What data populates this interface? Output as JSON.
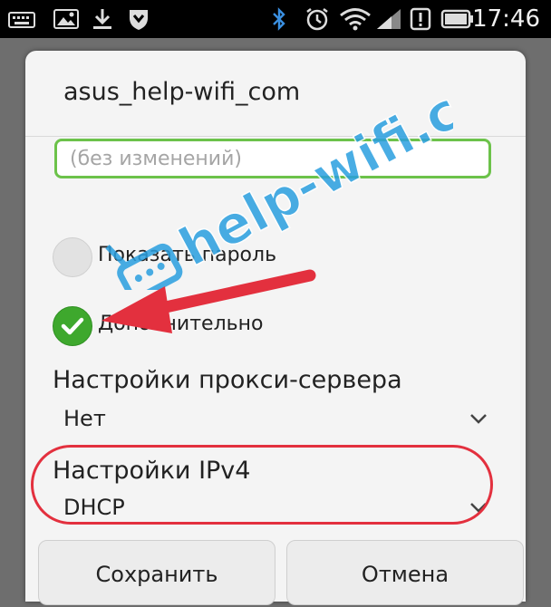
{
  "status_bar": {
    "time": "17:46",
    "icons": [
      "keyboard-icon",
      "image-icon",
      "download-icon",
      "shield-icon",
      "bluetooth-icon",
      "alarm-icon",
      "wifi-icon",
      "signal-icon",
      "alert-icon",
      "battery-icon"
    ]
  },
  "dialog": {
    "title": "asus_help-wifi_com",
    "password_placeholder": "(без изменений)",
    "show_password_label": "Показать пароль",
    "advanced_label": "Дополнительно",
    "proxy": {
      "title": "Настройки прокси-сервера",
      "value": "Нет"
    },
    "ipv4": {
      "title": "Настройки IPv4",
      "value": "DHCP"
    },
    "save_label": "Сохранить",
    "cancel_label": "Отмена"
  },
  "watermark": {
    "text": "help-wifi.com"
  },
  "colors": {
    "accent_green": "#3ea82d",
    "input_border": "#6cc24a",
    "highlight_red": "#e3303e",
    "watermark_blue": "#2a9fe0"
  }
}
